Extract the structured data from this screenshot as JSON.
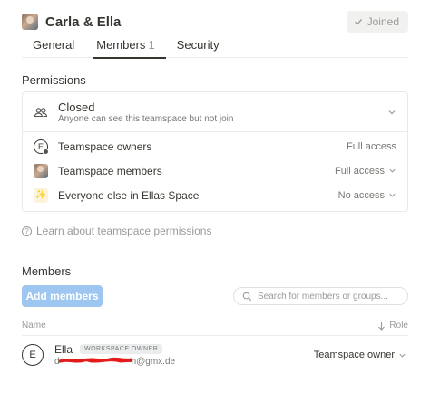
{
  "header": {
    "title": "Carla & Ella",
    "joined_label": "Joined"
  },
  "tabs": [
    {
      "label": "General",
      "count": ""
    },
    {
      "label": "Members",
      "count": "1"
    },
    {
      "label": "Security",
      "count": ""
    }
  ],
  "permissions": {
    "title": "Permissions",
    "closed": {
      "label": "Closed",
      "description": "Anyone can see this teamspace but not join"
    },
    "rows": [
      {
        "label": "Teamspace owners",
        "avatar_letter": "E",
        "access": "Full access",
        "has_dropdown": false
      },
      {
        "label": "Teamspace members",
        "access": "Full access",
        "has_dropdown": true
      },
      {
        "label": "Everyone else in Ellas Space",
        "icon": "sparkle-icon",
        "access": "No access",
        "has_dropdown": true
      }
    ],
    "learn_link": "Learn about teamspace permissions"
  },
  "members": {
    "title": "Members",
    "add_button": "Add members",
    "search_placeholder": "Search for members or groups...",
    "columns": {
      "name": "Name",
      "role": "Role"
    },
    "list": [
      {
        "avatar_letter": "E",
        "name": "Ella",
        "tag": "WORKSPACE OWNER",
        "email_prefix": "d",
        "email_suffix": "n@gmx.de",
        "role": "Teamspace owner"
      }
    ]
  },
  "colors": {
    "accent_button": "#9dc6f1",
    "redaction": "#e31b1b",
    "text": "#37352f",
    "muted": "#9b9a97"
  }
}
